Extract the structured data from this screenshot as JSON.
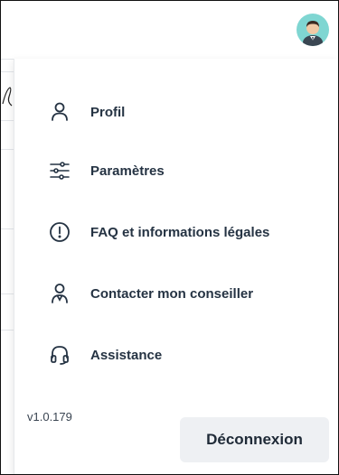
{
  "menu": {
    "items": [
      {
        "label": "Profil",
        "icon": "user-icon"
      },
      {
        "label": "Paramètres",
        "icon": "sliders-icon"
      },
      {
        "label": "FAQ et informations légales",
        "icon": "exclamation-circle-icon"
      },
      {
        "label": "Contacter mon conseiller",
        "icon": "advisor-icon"
      },
      {
        "label": "Assistance",
        "icon": "headset-icon"
      }
    ]
  },
  "footer": {
    "version": "v1.0.179",
    "logout_label": "Déconnexion"
  },
  "colors": {
    "avatar_bg": "#7fd6d2",
    "text": "#253343",
    "button_bg": "#eef0f3"
  }
}
